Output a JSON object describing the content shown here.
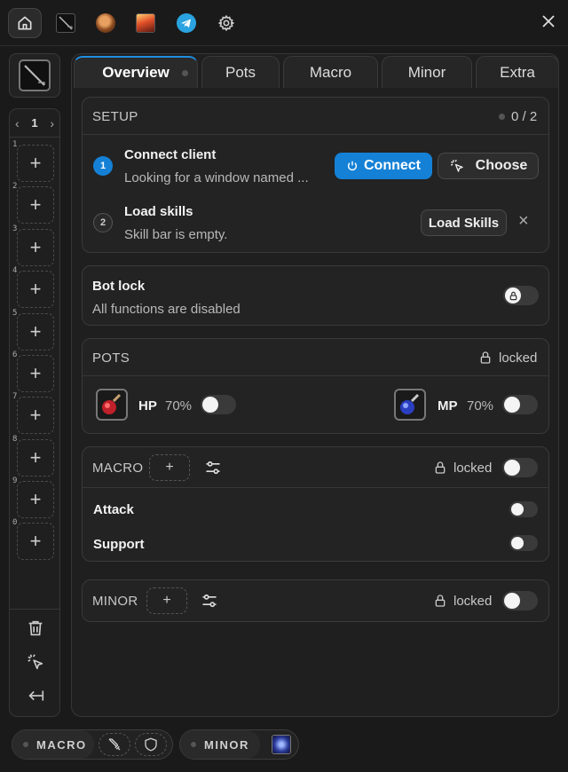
{
  "sidebar": {
    "page": "1",
    "prev": "‹",
    "next": "›",
    "slots": [
      {
        "num": "1",
        "plus": "+"
      },
      {
        "num": "2",
        "plus": "+"
      },
      {
        "num": "3",
        "plus": "+"
      },
      {
        "num": "4",
        "plus": "+"
      },
      {
        "num": "5",
        "plus": "+"
      },
      {
        "num": "6",
        "plus": "+"
      },
      {
        "num": "7",
        "plus": "+"
      },
      {
        "num": "8",
        "plus": "+"
      },
      {
        "num": "9",
        "plus": "+"
      },
      {
        "num": "0",
        "plus": "+"
      }
    ]
  },
  "tabs": [
    "Overview",
    "Pots",
    "Macro",
    "Minor",
    "Extra"
  ],
  "setup": {
    "title": "SETUP",
    "progress": "0 / 2",
    "step1": {
      "num": "1",
      "title": "Connect client",
      "subtitle": "Looking for a window named ...",
      "connect": "Connect",
      "choose": "Choose"
    },
    "step2": {
      "num": "2",
      "title": "Load skills",
      "subtitle": "Skill bar is empty.",
      "load": "Load Skills",
      "dismiss": "×"
    }
  },
  "botlock": {
    "title": "Bot lock",
    "subtitle": "All functions are disabled",
    "enabled": false
  },
  "pots": {
    "title": "POTS",
    "status": "locked",
    "hp": {
      "label": "HP",
      "pct": "70%",
      "enabled": false
    },
    "mp": {
      "label": "MP",
      "pct": "70%",
      "enabled": false
    }
  },
  "macro": {
    "title": "MACRO",
    "add": "+",
    "status": "locked",
    "items": [
      {
        "label": "Attack",
        "enabled": false
      },
      {
        "label": "Support",
        "enabled": false
      }
    ]
  },
  "minor": {
    "title": "MINOR",
    "add": "+",
    "status": "locked"
  },
  "bottom": {
    "macro": "MACRO",
    "minor": "MINOR"
  },
  "colors": {
    "accent": "#1581d6",
    "background": "#1a1a1a",
    "card": "#232323"
  }
}
